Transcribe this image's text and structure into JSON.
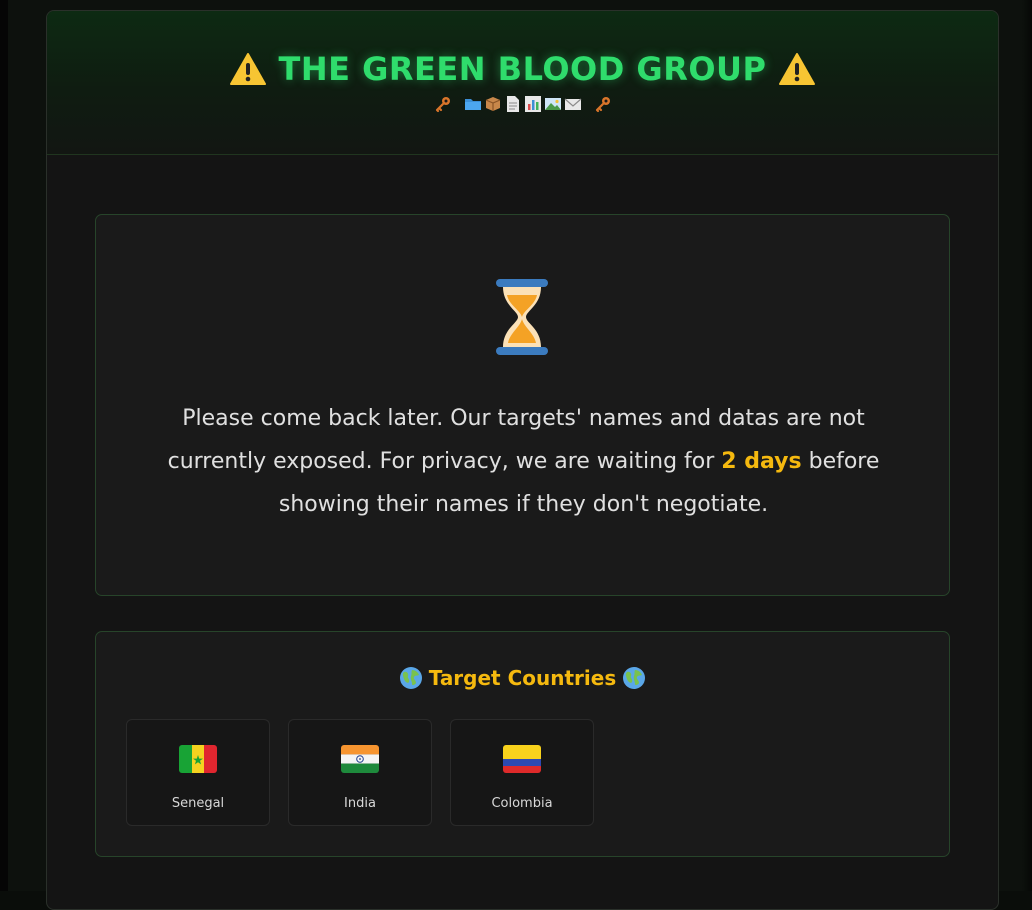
{
  "header": {
    "title": "THE GREEN BLOOD GROUP",
    "title_color": "#2fdc6c",
    "icons": [
      "key-icon",
      "folder-icon",
      "package-icon",
      "document-icon",
      "bar-chart-icon",
      "photo-icon",
      "envelope-icon",
      "key-icon"
    ]
  },
  "notice": {
    "icon": "hourglass-icon",
    "text_before": "Please come back later. Our targets' names and datas are not currently exposed. For privacy, we are waiting for ",
    "highlight": "2 days",
    "text_after": " before showing their names if they don't negotiate.",
    "highlight_color": "#f5b90f"
  },
  "countries": {
    "title": "Target Countries",
    "items": [
      {
        "name": "Senegal",
        "flag": "senegal-flag-icon"
      },
      {
        "name": "India",
        "flag": "india-flag-icon"
      },
      {
        "name": "Colombia",
        "flag": "colombia-flag-icon"
      }
    ]
  },
  "colors": {
    "background": "#141414",
    "card_border": "#27442a",
    "accent_green": "#2fdc6c",
    "accent_yellow": "#f5b90f"
  }
}
